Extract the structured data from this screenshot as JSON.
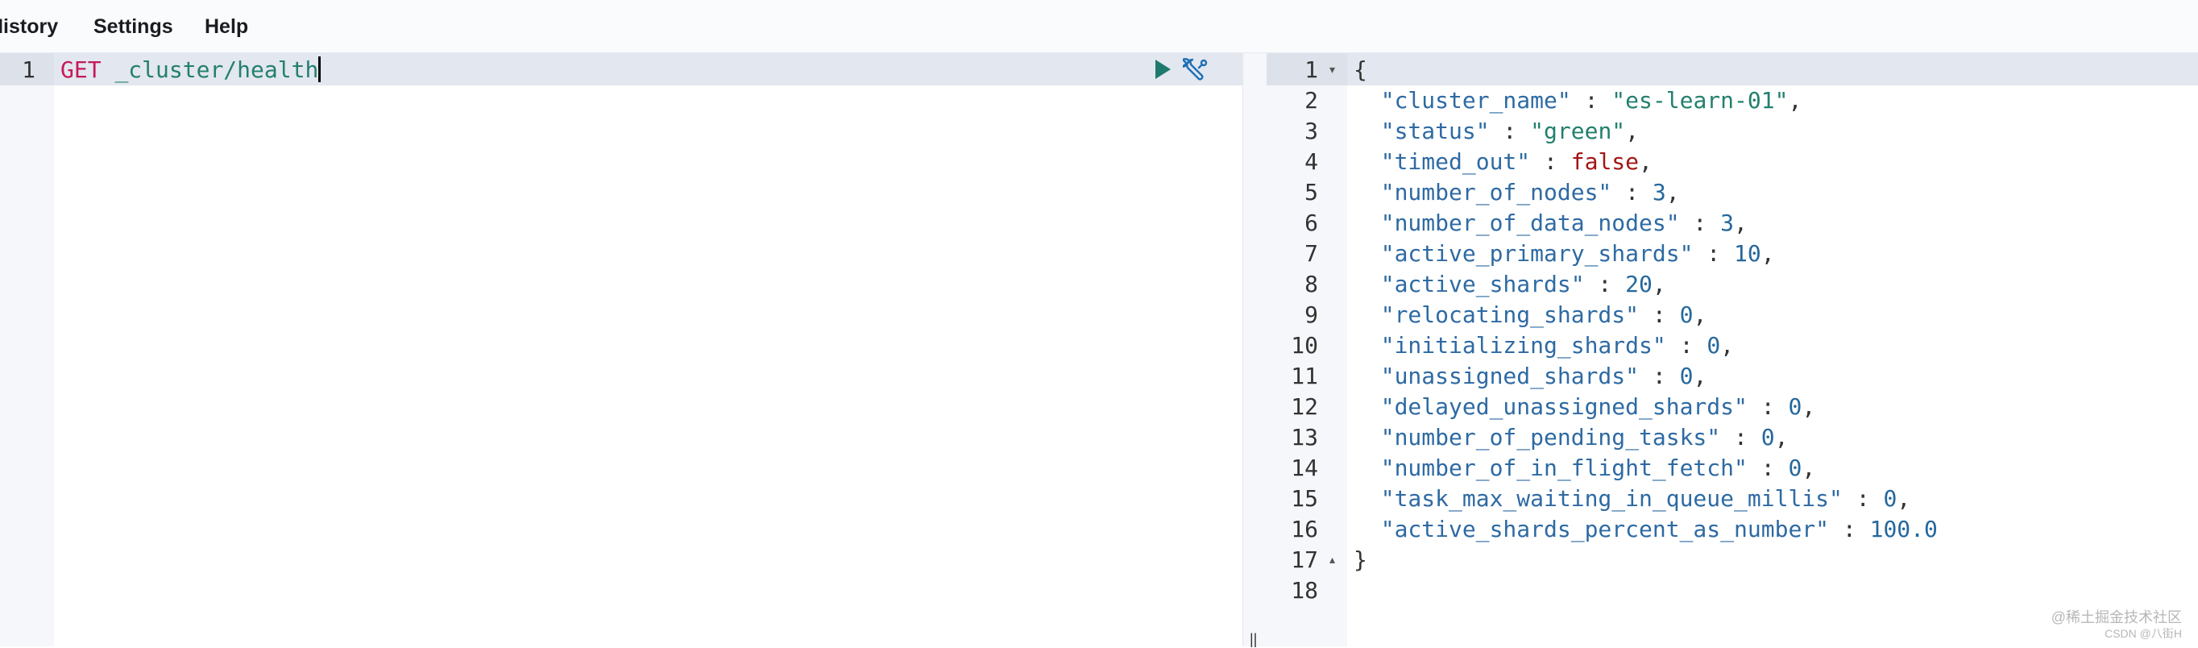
{
  "menu": {
    "history": "History",
    "settings": "Settings",
    "help": "Help"
  },
  "request": {
    "line_number": "1",
    "method": "GET",
    "path": "_cluster/health"
  },
  "icons": {
    "run": "play-icon",
    "settings": "wrench-icon",
    "resize": "resize-handle-icon"
  },
  "response": {
    "lines": [
      {
        "num": "1",
        "fold": "▾",
        "parts": [
          {
            "t": "{",
            "c": "p"
          }
        ]
      },
      {
        "num": "2",
        "fold": "",
        "parts": [
          {
            "t": "  \"cluster_name\"",
            "c": "k"
          },
          {
            "t": " : ",
            "c": "p"
          },
          {
            "t": "\"es-learn-01\"",
            "c": "s"
          },
          {
            "t": ",",
            "c": "p"
          }
        ]
      },
      {
        "num": "3",
        "fold": "",
        "parts": [
          {
            "t": "  \"status\"",
            "c": "k"
          },
          {
            "t": " : ",
            "c": "p"
          },
          {
            "t": "\"green\"",
            "c": "s"
          },
          {
            "t": ",",
            "c": "p"
          }
        ]
      },
      {
        "num": "4",
        "fold": "",
        "parts": [
          {
            "t": "  \"timed_out\"",
            "c": "k"
          },
          {
            "t": " : ",
            "c": "p"
          },
          {
            "t": "false",
            "c": "b"
          },
          {
            "t": ",",
            "c": "p"
          }
        ]
      },
      {
        "num": "5",
        "fold": "",
        "parts": [
          {
            "t": "  \"number_of_nodes\"",
            "c": "k"
          },
          {
            "t": " : ",
            "c": "p"
          },
          {
            "t": "3",
            "c": "n"
          },
          {
            "t": ",",
            "c": "p"
          }
        ]
      },
      {
        "num": "6",
        "fold": "",
        "parts": [
          {
            "t": "  \"number_of_data_nodes\"",
            "c": "k"
          },
          {
            "t": " : ",
            "c": "p"
          },
          {
            "t": "3",
            "c": "n"
          },
          {
            "t": ",",
            "c": "p"
          }
        ]
      },
      {
        "num": "7",
        "fold": "",
        "parts": [
          {
            "t": "  \"active_primary_shards\"",
            "c": "k"
          },
          {
            "t": " : ",
            "c": "p"
          },
          {
            "t": "10",
            "c": "n"
          },
          {
            "t": ",",
            "c": "p"
          }
        ]
      },
      {
        "num": "8",
        "fold": "",
        "parts": [
          {
            "t": "  \"active_shards\"",
            "c": "k"
          },
          {
            "t": " : ",
            "c": "p"
          },
          {
            "t": "20",
            "c": "n"
          },
          {
            "t": ",",
            "c": "p"
          }
        ]
      },
      {
        "num": "9",
        "fold": "",
        "parts": [
          {
            "t": "  \"relocating_shards\"",
            "c": "k"
          },
          {
            "t": " : ",
            "c": "p"
          },
          {
            "t": "0",
            "c": "n"
          },
          {
            "t": ",",
            "c": "p"
          }
        ]
      },
      {
        "num": "10",
        "fold": "",
        "parts": [
          {
            "t": "  \"initializing_shards\"",
            "c": "k"
          },
          {
            "t": " : ",
            "c": "p"
          },
          {
            "t": "0",
            "c": "n"
          },
          {
            "t": ",",
            "c": "p"
          }
        ]
      },
      {
        "num": "11",
        "fold": "",
        "parts": [
          {
            "t": "  \"unassigned_shards\"",
            "c": "k"
          },
          {
            "t": " : ",
            "c": "p"
          },
          {
            "t": "0",
            "c": "n"
          },
          {
            "t": ",",
            "c": "p"
          }
        ]
      },
      {
        "num": "12",
        "fold": "",
        "parts": [
          {
            "t": "  \"delayed_unassigned_shards\"",
            "c": "k"
          },
          {
            "t": " : ",
            "c": "p"
          },
          {
            "t": "0",
            "c": "n"
          },
          {
            "t": ",",
            "c": "p"
          }
        ]
      },
      {
        "num": "13",
        "fold": "",
        "parts": [
          {
            "t": "  \"number_of_pending_tasks\"",
            "c": "k"
          },
          {
            "t": " : ",
            "c": "p"
          },
          {
            "t": "0",
            "c": "n"
          },
          {
            "t": ",",
            "c": "p"
          }
        ]
      },
      {
        "num": "14",
        "fold": "",
        "parts": [
          {
            "t": "  \"number_of_in_flight_fetch\"",
            "c": "k"
          },
          {
            "t": " : ",
            "c": "p"
          },
          {
            "t": "0",
            "c": "n"
          },
          {
            "t": ",",
            "c": "p"
          }
        ]
      },
      {
        "num": "15",
        "fold": "",
        "parts": [
          {
            "t": "  \"task_max_waiting_in_queue_millis\"",
            "c": "k"
          },
          {
            "t": " : ",
            "c": "p"
          },
          {
            "t": "0",
            "c": "n"
          },
          {
            "t": ",",
            "c": "p"
          }
        ]
      },
      {
        "num": "16",
        "fold": "",
        "parts": [
          {
            "t": "  \"active_shards_percent_as_number\"",
            "c": "k"
          },
          {
            "t": " : ",
            "c": "p"
          },
          {
            "t": "100.0",
            "c": "n"
          }
        ]
      },
      {
        "num": "17",
        "fold": "▴",
        "parts": [
          {
            "t": "}",
            "c": "p"
          }
        ]
      },
      {
        "num": "18",
        "fold": "",
        "parts": []
      }
    ]
  },
  "colors": {
    "method": "#c41a5a",
    "url": "#23806e",
    "key": "#2e6aa3",
    "string": "#23806e",
    "number": "#25689c",
    "boolean": "#a31515",
    "active_line": "#e3e7ef",
    "run_button": "#1f7a6d"
  },
  "watermark": {
    "line1": "@稀土掘金技术社区",
    "line2": "CSDN @八街H"
  }
}
